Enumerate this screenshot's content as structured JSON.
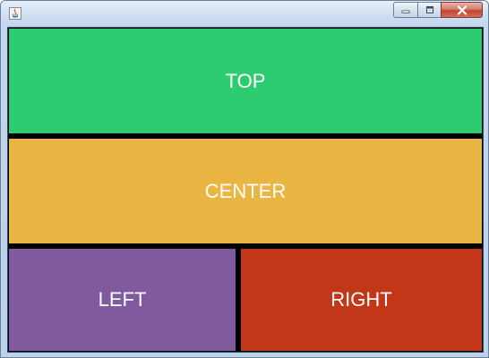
{
  "window": {
    "title": "",
    "buttons": {
      "minimize_icon": "minimize-icon",
      "maximize_icon": "maximize-icon",
      "close_icon": "close-icon"
    }
  },
  "panels": {
    "top": {
      "label": "TOP",
      "color": "#2ecc71"
    },
    "center": {
      "label": "CENTER",
      "color": "#eab543"
    },
    "left": {
      "label": "LEFT",
      "color": "#7f5a9f"
    },
    "right": {
      "label": "RIGHT",
      "color": "#c13718"
    }
  },
  "separator_color": "#000000"
}
